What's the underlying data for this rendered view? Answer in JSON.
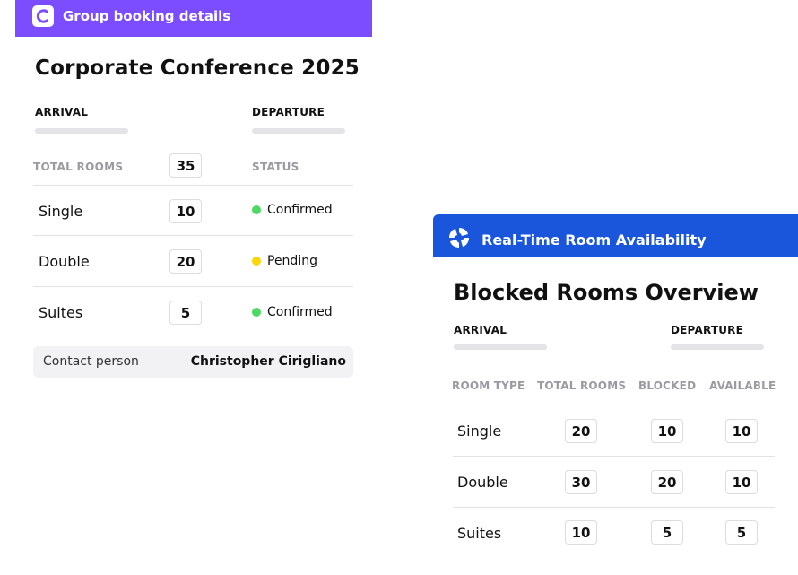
{
  "group_booking": {
    "header_title": "Group booking details",
    "event_title": "Corporate Conference 2025",
    "arrival_label": "ARRIVAL",
    "departure_label": "DEPARTURE",
    "total_rooms_label": "TOTAL ROOMS",
    "total_rooms_value": "35",
    "status_label": "STATUS",
    "rows": [
      {
        "room": "Single",
        "count": "10",
        "status": "Confirmed",
        "status_color": "#4cd964"
      },
      {
        "room": "Double",
        "count": "20",
        "status": "Pending",
        "status_color": "#ffd60a"
      },
      {
        "room": "Suites",
        "count": "5",
        "status": "Confirmed",
        "status_color": "#4cd964"
      }
    ],
    "contact_label": "Contact person",
    "contact_value": "Christopher Cirigliano",
    "accent_color": "#7c4dff"
  },
  "availability": {
    "header_title": "Real-Time Room Availability",
    "overview_title": "Blocked Rooms Overview",
    "arrival_label": "ARRIVAL",
    "departure_label": "DEPARTURE",
    "columns": [
      "ROOM TYPE",
      "TOTAL ROOMS",
      "BLOCKED",
      "AVAILABLE"
    ],
    "rows": [
      {
        "room": "Single",
        "total": "20",
        "blocked": "10",
        "available": "10"
      },
      {
        "room": "Double",
        "total": "30",
        "blocked": "20",
        "available": "10"
      },
      {
        "room": "Suites",
        "total": "10",
        "blocked": "5",
        "available": "5"
      }
    ],
    "accent_color": "#1a56db"
  }
}
